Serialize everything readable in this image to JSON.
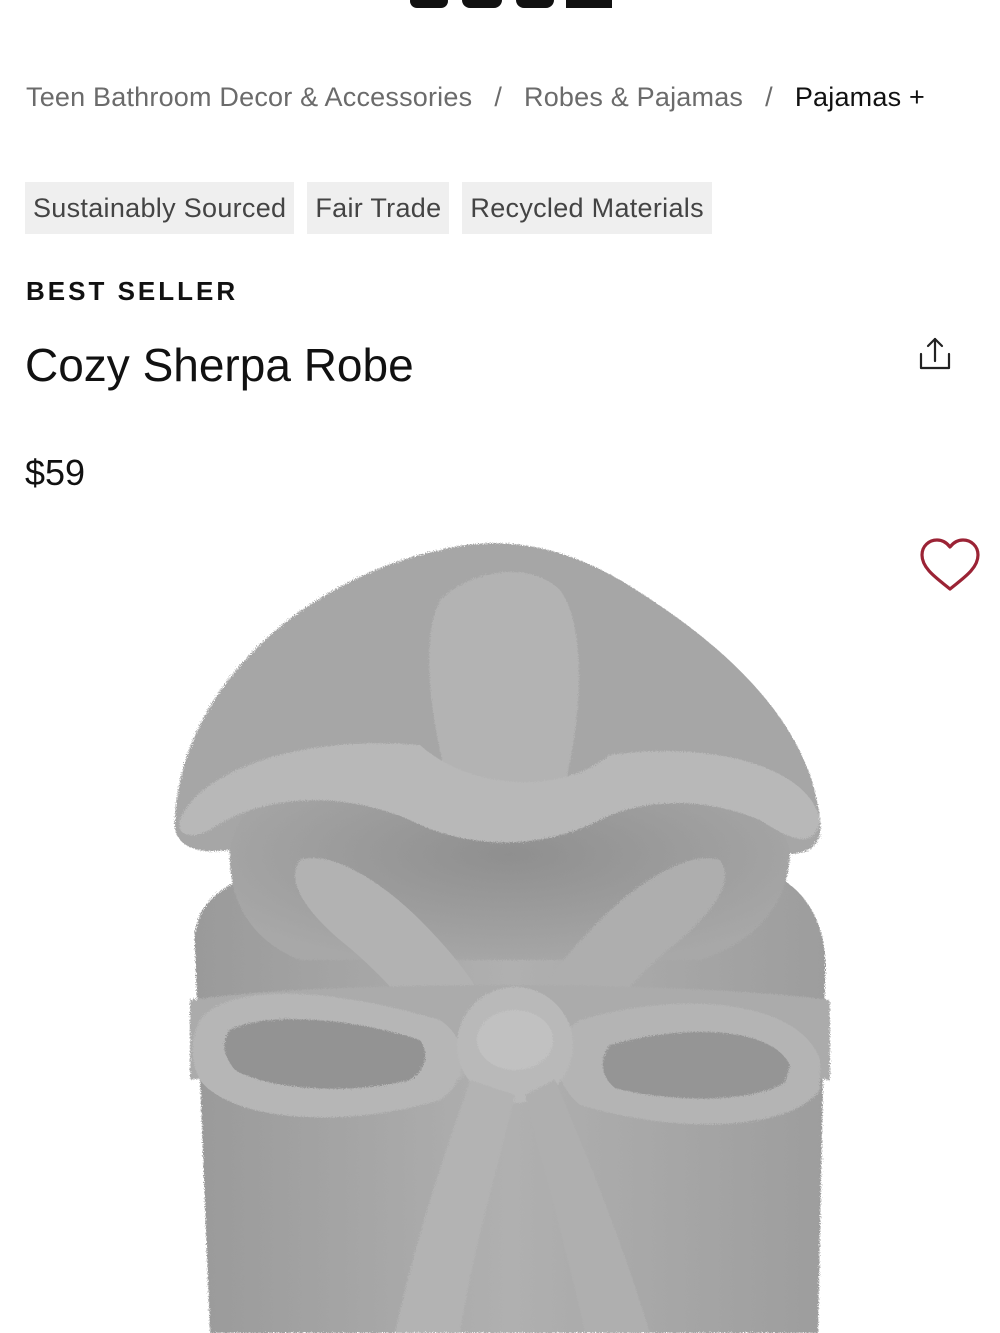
{
  "breadcrumb": {
    "items": [
      {
        "label": "Teen Bathroom Decor & Accessories"
      },
      {
        "label": "Robes & Pajamas"
      },
      {
        "label": "Pajamas +"
      }
    ],
    "separator": "/"
  },
  "tags": [
    {
      "label": "Sustainably Sourced"
    },
    {
      "label": "Fair Trade"
    },
    {
      "label": "Recycled Materials"
    }
  ],
  "product": {
    "badge": "BEST SELLER",
    "title": "Cozy Sherpa Robe",
    "price": "$59"
  },
  "icons": {
    "share": "share-icon",
    "favorite": "heart-icon"
  },
  "colors": {
    "heart": "#9b2335",
    "tag_bg": "#efefef",
    "robe": "#a9a9a9"
  }
}
